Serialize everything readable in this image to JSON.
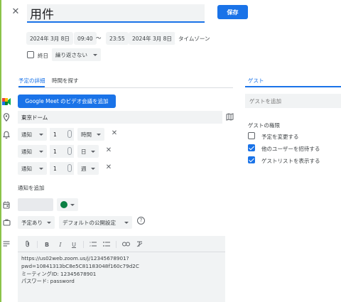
{
  "header": {
    "title_value": "用件",
    "save_label": "保存"
  },
  "datetime": {
    "start_date": "2024年 3月 8日",
    "start_time": "09:40",
    "separator": "〜",
    "end_time": "23:55",
    "end_date": "2024年 3月 8日",
    "timezone_label": "タイムゾーン",
    "allday_label": "終日",
    "repeat_label": "繰り返さない"
  },
  "tabs": {
    "details": "予定の詳細",
    "find_time": "時間を探す",
    "guests": "ゲスト"
  },
  "details": {
    "meet_button": "Google Meet のビデオ会議を追加",
    "location_value": "東京ドーム",
    "notifications": [
      {
        "type": "通知",
        "amount": "1",
        "unit": "時間"
      },
      {
        "type": "通知",
        "amount": "1",
        "unit": "日"
      },
      {
        "type": "通知",
        "amount": "1",
        "unit": "週"
      }
    ],
    "add_notification": "通知を追加",
    "availability": "予定あり",
    "visibility": "デフォルトの公開設定",
    "event_color": "#0b8043"
  },
  "description": {
    "toolbar": {
      "bold": "B",
      "italic": "I",
      "underline": "U"
    },
    "lines": [
      "https://us02web.zoom.us/j/12345678901?",
      "pwd=10841313bC8e5C81183048f160c79d2C",
      "ミーティングID: 12345678901",
      "パスワード: password"
    ]
  },
  "guests": {
    "placeholder": "ゲストを追加",
    "permissions_title": "ゲストの権限",
    "permissions": [
      {
        "label": "予定を変更する",
        "checked": false
      },
      {
        "label": "他のユーザーを招待する",
        "checked": true
      },
      {
        "label": "ゲストリストを表示する",
        "checked": true
      }
    ]
  },
  "colors": {
    "accent": "#1a73e8",
    "field_bg": "#f1f3f4",
    "window_edge": "#8bc34a"
  }
}
